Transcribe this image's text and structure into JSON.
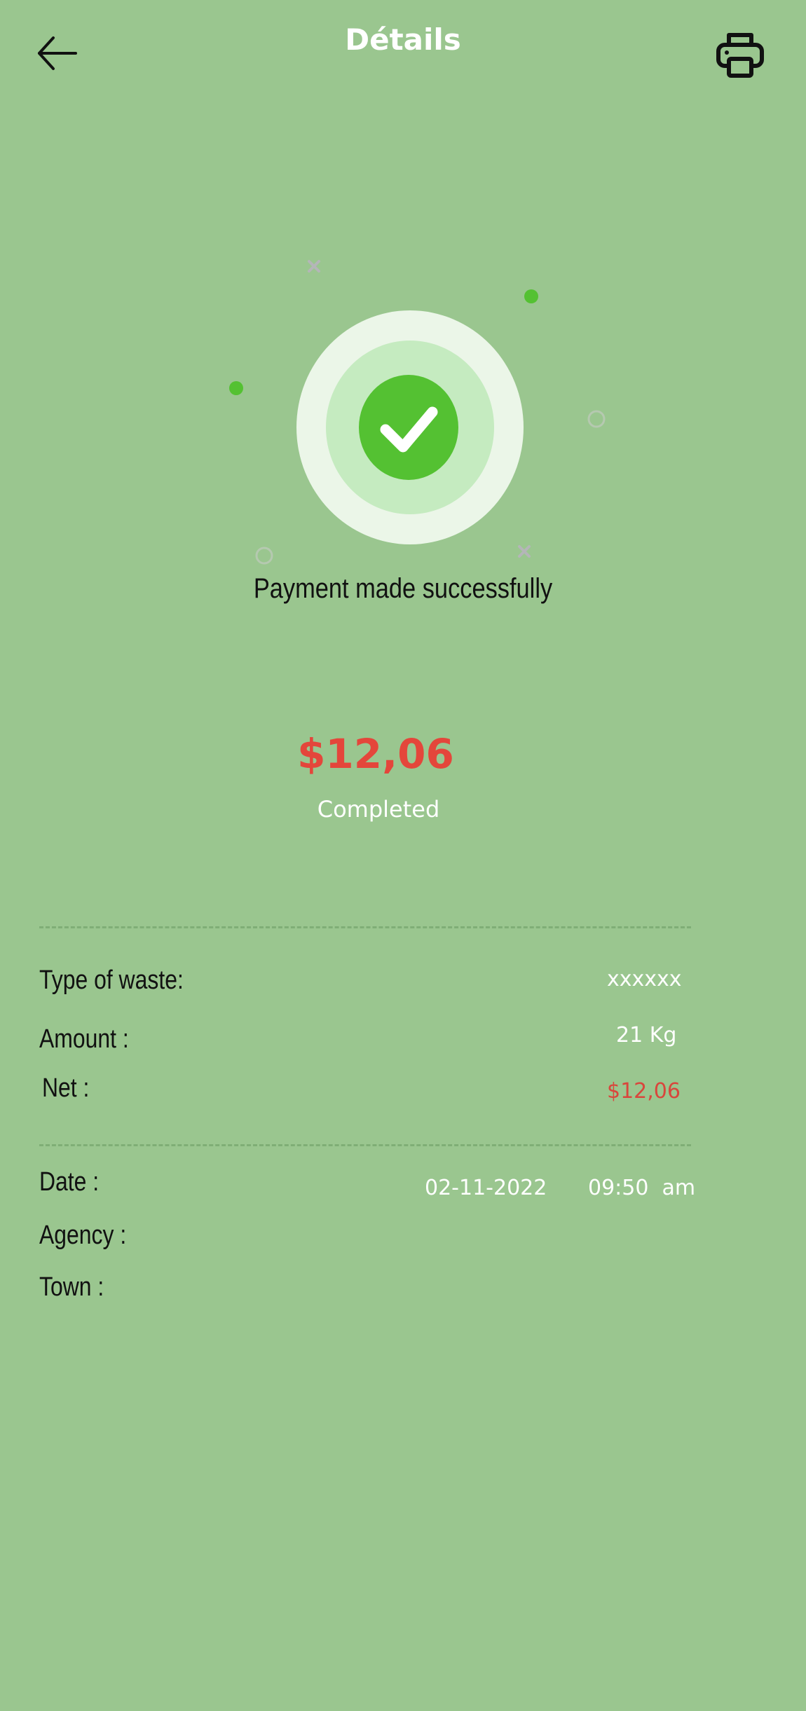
{
  "header": {
    "title": "Détails",
    "back_icon": "arrow-left-icon",
    "print_icon": "printer-icon"
  },
  "success": {
    "icon": "check-circle-icon",
    "message": "Payment made successfully"
  },
  "payment": {
    "amount": "$12,06",
    "status": "Completed"
  },
  "details": {
    "waste_type_label": "Type of waste:",
    "waste_type_value": "xxxxxx",
    "amount_label": "Amount :",
    "amount_value": "21 Kg",
    "net_label": "Net :",
    "net_value": "$12,06",
    "date_label": "Date :",
    "date_value": "02-11-2022",
    "time_value": "09:50  am",
    "agency_label": "Agency :",
    "town_label": "Town :"
  },
  "colors": {
    "background": "#9ac68f",
    "accent_green": "#54c132",
    "amount_red": "#e4463b"
  }
}
